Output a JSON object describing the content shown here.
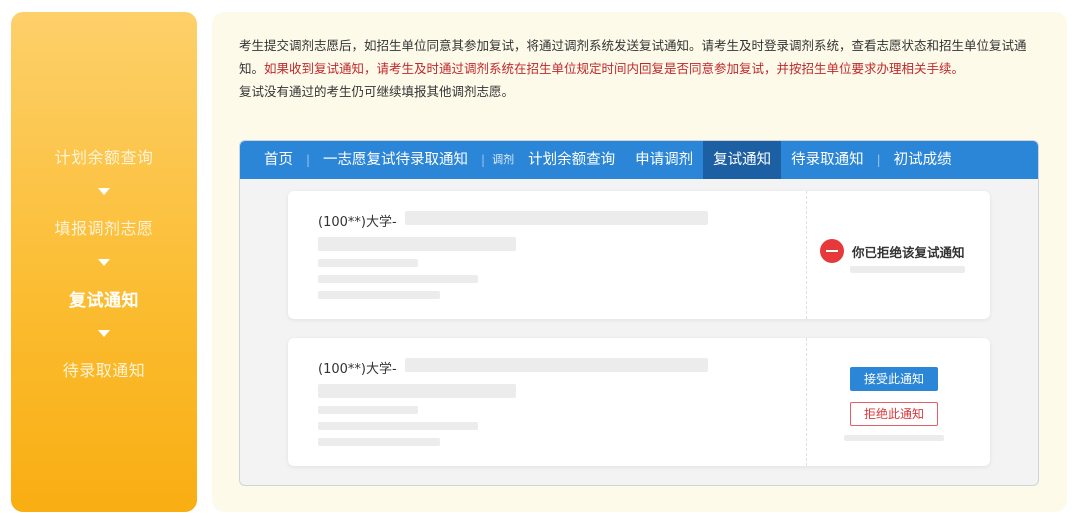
{
  "steps": [
    {
      "label": "计划余额查询",
      "active": false
    },
    {
      "label": "填报调剂志愿",
      "active": false
    },
    {
      "label": "复试通知",
      "active": true
    },
    {
      "label": "待录取通知",
      "active": false
    }
  ],
  "intro": {
    "part1": "考生提交调剂志愿后，如招生单位同意其参加复试，将通过调剂系统发送复试通知。请考生及时登录调剂系统，查看志愿状态和招生单位复试通知。",
    "part2_red": "如果收到复试通知，请考生及时通过调剂系统在招生单位规定时间内回复是否同意参加复试，并按招生单位要求办理相关手续。",
    "line3": "复试没有通过的考生仍可继续填报其他调剂志愿。"
  },
  "nav": {
    "items": [
      "首页",
      "一志愿复试待录取通知",
      "调剂",
      "计划余额查询",
      "申请调剂",
      "复试通知",
      "待录取通知",
      "初试成绩"
    ],
    "active": "复试通知"
  },
  "cards": [
    {
      "university": "(100**)大学-",
      "status": "你已拒绝该复试通知"
    },
    {
      "university": "(100**)大学-",
      "accept_label": "接受此通知",
      "reject_label": "拒绝此通知"
    }
  ],
  "colors": {
    "accent": "#2c86d8",
    "warning": "#c0282c",
    "panel": "#fbbd33"
  }
}
